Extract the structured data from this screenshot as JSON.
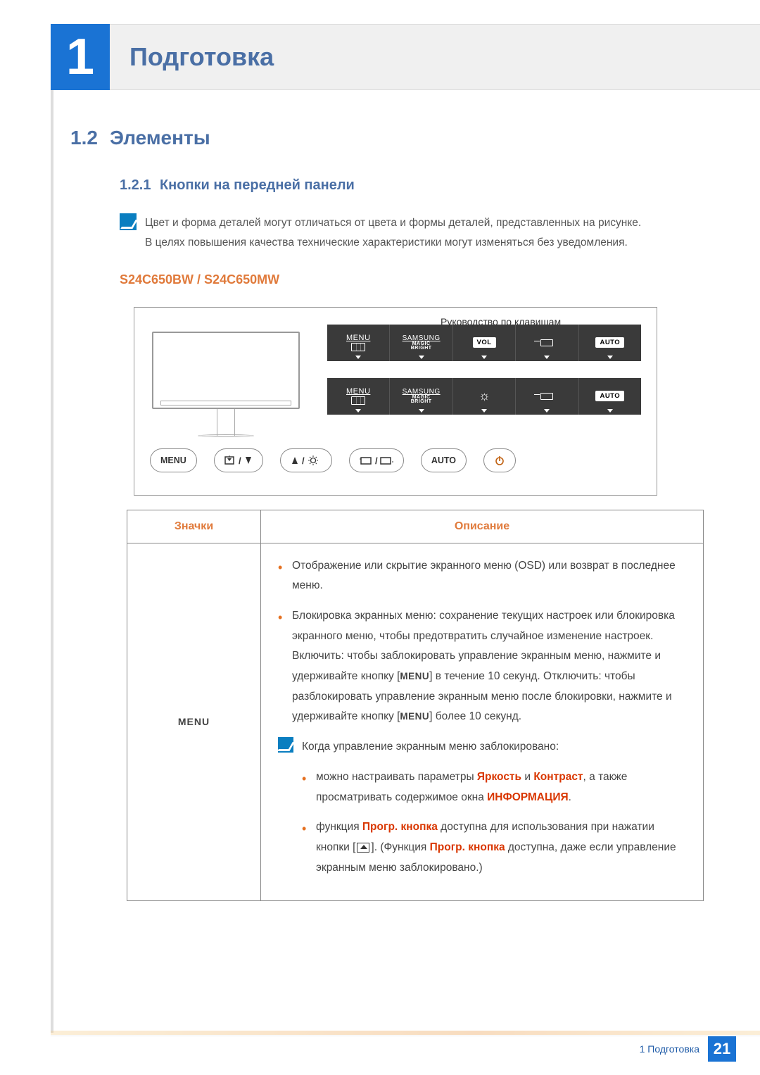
{
  "chapter": {
    "number": "1",
    "title": "Подготовка"
  },
  "section": {
    "number": "1.2",
    "title": "Элементы"
  },
  "subsection": {
    "number": "1.2.1",
    "title": "Кнопки на передней панели"
  },
  "note1": {
    "line1": "Цвет и форма деталей могут отличаться от цвета и формы деталей, представленных на рисунке.",
    "line2": "В целях повышения качества технические характеристики могут изменяться без уведомления."
  },
  "model_heading": "S24C650BW / S24C650MW",
  "diagram": {
    "key_guide_label": "Руководство по клавишам",
    "osd1": {
      "c1": {
        "label": "MENU"
      },
      "c2": {
        "brand": "SAMSUNG",
        "sub1": "MAGIC",
        "sub2": "BRIGHT"
      },
      "c3": {
        "box": "VOL"
      },
      "c4": {},
      "c5": {
        "box": "AUTO"
      }
    },
    "osd2": {
      "c1": {
        "label": "MENU"
      },
      "c2": {
        "brand": "SAMSUNG",
        "sub1": "MAGIC",
        "sub2": "BRIGHT"
      },
      "c3": {},
      "c4": {},
      "c5": {
        "box": "AUTO"
      }
    },
    "buttons": {
      "b1": "MENU",
      "b5": "AUTO"
    }
  },
  "table": {
    "header_icons": "Значки",
    "header_desc": "Описание",
    "row1": {
      "icon_label": "MENU",
      "bullet1": "Отображение или скрытие экранного меню (OSD) или возврат в последнее меню.",
      "bullet2_a": "Блокировка экранных меню: сохранение текущих настроек или блокировка экранного меню, чтобы предотвратить случайное изменение настроек. Включить: чтобы заблокировать управление экранным меню, нажмите и удерживайте кнопку [",
      "bullet2_menu1": "MENU",
      "bullet2_b": "] в течение 10 секунд. Отключить: чтобы разблокировать управление экранным меню после блокировки, нажмите и удерживайте кнопку [",
      "bullet2_menu2": "MENU",
      "bullet2_c": "] более 10 секунд.",
      "note_lead": "Когда управление экранным меню заблокировано:",
      "sub1_a": "можно настраивать параметры ",
      "sub1_k1": "Яркость",
      "sub1_b": " и ",
      "sub1_k2": "Контраст",
      "sub1_c": ", а также просматривать содержимое окна ",
      "sub1_k3": "ИНФОРМАЦИЯ",
      "sub1_d": ".",
      "sub2_a": "функция ",
      "sub2_k1": "Прогр. кнопка",
      "sub2_b": " доступна для использования при нажатии кнопки [",
      "sub2_c": "]. (Функция ",
      "sub2_k2": "Прогр. кнопка",
      "sub2_d": " доступна, даже если управление экранным меню заблокировано.)"
    }
  },
  "footer": {
    "text": "1 Подготовка",
    "page": "21"
  }
}
